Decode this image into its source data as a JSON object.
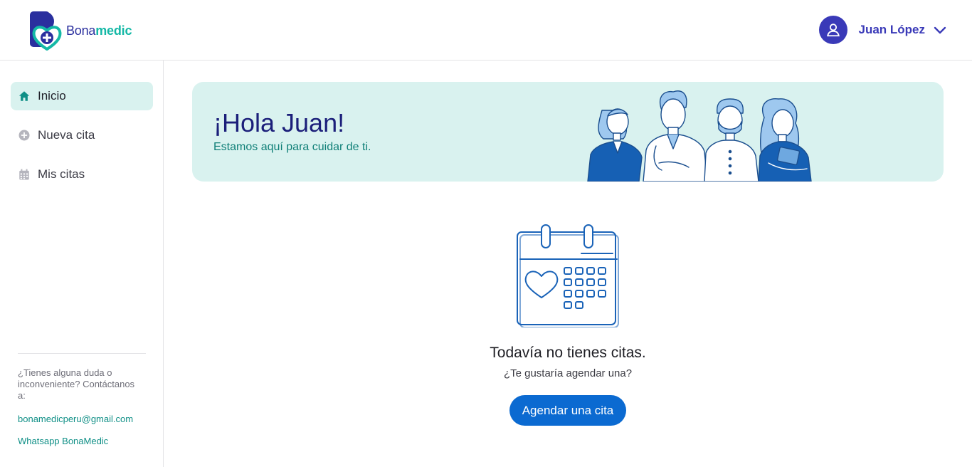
{
  "header": {
    "brand_part1": "Bona",
    "brand_part2": "medic",
    "user_name": "Juan López",
    "icons": {
      "user": "user-icon",
      "chevron": "chevron-down-icon",
      "logo": "heart-cross-logo"
    }
  },
  "sidebar": {
    "items": [
      {
        "label": "Inicio",
        "icon": "home-icon",
        "active": true
      },
      {
        "label": "Nueva cita",
        "icon": "plus-circle-icon",
        "active": false
      },
      {
        "label": "Mis citas",
        "icon": "calendar-icon",
        "active": false
      }
    ],
    "help_text": "¿Tienes alguna duda o inconveniente? Contáctanos a:",
    "email": "bonamedicperu@gmail.com",
    "whatsapp": "Whatsapp BonaMedic"
  },
  "banner": {
    "title": "¡Hola Juan!",
    "subtitle": "Estamos aquí para cuidar de ti."
  },
  "empty_state": {
    "title": "Todavía no tienes citas.",
    "subtitle": "¿Te gustaría agendar una?",
    "button": "Agendar una cita",
    "icon": "calendar-heart-icon"
  },
  "colors": {
    "brand_navy": "#2a2f9e",
    "brand_teal": "#14b8a6",
    "banner_bg": "#d9f2ef",
    "primary_button": "#0b6ad1"
  }
}
